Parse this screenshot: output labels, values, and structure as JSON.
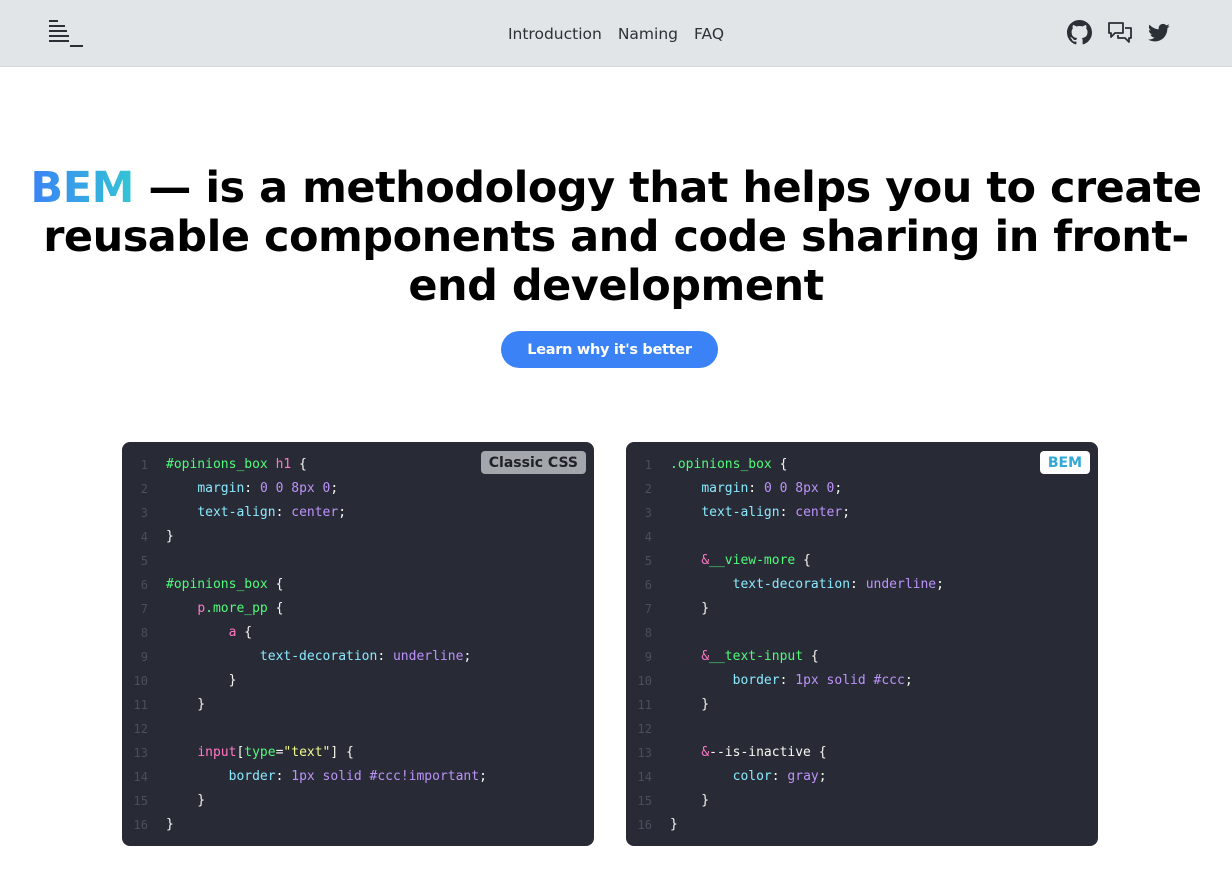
{
  "header": {
    "nav": [
      "Introduction",
      "Naming",
      "FAQ"
    ],
    "icons": [
      "github-icon",
      "chat-icon",
      "twitter-icon"
    ]
  },
  "hero": {
    "title_accent": "BEM",
    "title_rest": " — is a methodology that helps you to create reusable components and code sharing in front-end development",
    "cta_label": "Learn why it's better"
  },
  "colors": {
    "accent": "#3b82f6",
    "accent_end": "#33c6d4",
    "code_bg": "#282a36"
  },
  "panels": [
    {
      "badge": "Classic CSS",
      "lines": [
        [
          [
            "c-sel",
            "#opinions_box"
          ],
          [
            "c-pun",
            " "
          ],
          [
            "c-tag",
            "h1"
          ],
          [
            "c-pun",
            " {"
          ]
        ],
        [
          [
            "c-pun",
            "    "
          ],
          [
            "c-prop",
            "margin"
          ],
          [
            "c-pun",
            ": "
          ],
          [
            "c-val",
            "0 0 8px 0"
          ],
          [
            "c-pun",
            ";"
          ]
        ],
        [
          [
            "c-pun",
            "    "
          ],
          [
            "c-prop",
            "text-align"
          ],
          [
            "c-pun",
            ": "
          ],
          [
            "c-val",
            "center"
          ],
          [
            "c-pun",
            ";"
          ]
        ],
        [
          [
            "c-pun",
            "}"
          ]
        ],
        [],
        [
          [
            "c-sel",
            "#opinions_box"
          ],
          [
            "c-pun",
            " {"
          ]
        ],
        [
          [
            "c-pun",
            "    "
          ],
          [
            "c-tag",
            "p"
          ],
          [
            "c-sel",
            ".more_pp"
          ],
          [
            "c-pun",
            " {"
          ]
        ],
        [
          [
            "c-pun",
            "        "
          ],
          [
            "c-tag",
            "a"
          ],
          [
            "c-pun",
            " {"
          ]
        ],
        [
          [
            "c-pun",
            "            "
          ],
          [
            "c-prop",
            "text-decoration"
          ],
          [
            "c-pun",
            ": "
          ],
          [
            "c-val",
            "underline"
          ],
          [
            "c-pun",
            ";"
          ]
        ],
        [
          [
            "c-pun",
            "        }"
          ]
        ],
        [
          [
            "c-pun",
            "    }"
          ]
        ],
        [],
        [
          [
            "c-pun",
            "    "
          ],
          [
            "c-tag",
            "input"
          ],
          [
            "c-pun",
            "["
          ],
          [
            "c-sel",
            "type"
          ],
          [
            "c-pun",
            "="
          ],
          [
            "c-str",
            "\"text\""
          ],
          [
            "c-pun",
            "] {"
          ]
        ],
        [
          [
            "c-pun",
            "        "
          ],
          [
            "c-prop",
            "border"
          ],
          [
            "c-pun",
            ": "
          ],
          [
            "c-val",
            "1px solid #ccc!important"
          ],
          [
            "c-pun",
            ";"
          ]
        ],
        [
          [
            "c-pun",
            "    }"
          ]
        ],
        [
          [
            "c-pun",
            "}"
          ]
        ]
      ]
    },
    {
      "badge": "BEM",
      "lines": [
        [
          [
            "c-sel",
            ".opinions_box"
          ],
          [
            "c-pun",
            " {"
          ]
        ],
        [
          [
            "c-pun",
            "    "
          ],
          [
            "c-prop",
            "margin"
          ],
          [
            "c-pun",
            ": "
          ],
          [
            "c-val",
            "0 0 8px 0"
          ],
          [
            "c-pun",
            ";"
          ]
        ],
        [
          [
            "c-pun",
            "    "
          ],
          [
            "c-prop",
            "text-align"
          ],
          [
            "c-pun",
            ": "
          ],
          [
            "c-val",
            "center"
          ],
          [
            "c-pun",
            ";"
          ]
        ],
        [],
        [
          [
            "c-pun",
            "    "
          ],
          [
            "c-amp",
            "&"
          ],
          [
            "c-sel",
            "__view-more"
          ],
          [
            "c-pun",
            " {"
          ]
        ],
        [
          [
            "c-pun",
            "        "
          ],
          [
            "c-prop",
            "text-decoration"
          ],
          [
            "c-pun",
            ": "
          ],
          [
            "c-val",
            "underline"
          ],
          [
            "c-pun",
            ";"
          ]
        ],
        [
          [
            "c-pun",
            "    }"
          ]
        ],
        [],
        [
          [
            "c-pun",
            "    "
          ],
          [
            "c-amp",
            "&"
          ],
          [
            "c-sel",
            "__text-input"
          ],
          [
            "c-pun",
            " {"
          ]
        ],
        [
          [
            "c-pun",
            "        "
          ],
          [
            "c-prop",
            "border"
          ],
          [
            "c-pun",
            ": "
          ],
          [
            "c-val",
            "1px solid #ccc"
          ],
          [
            "c-pun",
            ";"
          ]
        ],
        [
          [
            "c-pun",
            "    }"
          ]
        ],
        [],
        [
          [
            "c-pun",
            "    "
          ],
          [
            "c-amp",
            "&"
          ],
          [
            "c-pun",
            "--is-inactive {"
          ]
        ],
        [
          [
            "c-pun",
            "        "
          ],
          [
            "c-prop",
            "color"
          ],
          [
            "c-pun",
            ": "
          ],
          [
            "c-val",
            "gray"
          ],
          [
            "c-pun",
            ";"
          ]
        ],
        [
          [
            "c-pun",
            "    }"
          ]
        ],
        [
          [
            "c-pun",
            "}"
          ]
        ]
      ]
    }
  ]
}
